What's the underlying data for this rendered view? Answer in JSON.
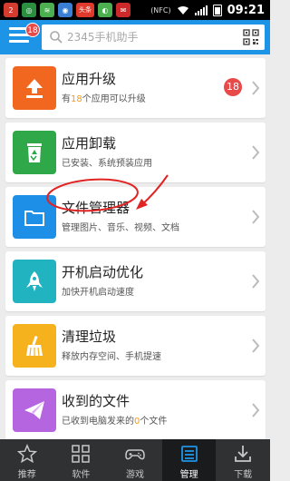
{
  "status_bar": {
    "time": "09:21",
    "nfc": "(NFC)",
    "left_icons": [
      {
        "name": "notification-app-icon",
        "color": "#d63b2f",
        "glyph": "2"
      },
      {
        "name": "sync-icon",
        "color": "#2a8f3e",
        "glyph": "◎"
      },
      {
        "name": "wifi-app-icon",
        "color": "#4caf50",
        "glyph": "≋"
      },
      {
        "name": "app-icon",
        "color": "#3a7fd5",
        "glyph": "◉"
      },
      {
        "name": "news-app-icon",
        "color": "#e03a2c",
        "glyph": "头条"
      },
      {
        "name": "app-icon-2",
        "color": "#4caf50",
        "glyph": "◐"
      },
      {
        "name": "app-icon-3",
        "color": "#cc2a2a",
        "glyph": "✉"
      }
    ]
  },
  "header": {
    "menu_badge": "18",
    "search_placeholder": "2345手机助手"
  },
  "items": [
    {
      "title": "应用升级",
      "sub_prefix": "有",
      "sub_highlight": "18",
      "sub_suffix": "个应用可以升级",
      "badge": "18",
      "color": "#f2671f"
    },
    {
      "title": "应用卸载",
      "sub_prefix": "已安装、系统预装应用",
      "sub_highlight": "",
      "sub_suffix": "",
      "badge": "",
      "color": "#2fa84a"
    },
    {
      "title": "文件管理器",
      "sub_prefix": "管理图片、音乐、视频、文档",
      "sub_highlight": "",
      "sub_suffix": "",
      "badge": "",
      "color": "#1e8fe6"
    },
    {
      "title": "开机启动优化",
      "sub_prefix": "加快开机启动速度",
      "sub_highlight": "",
      "sub_suffix": "",
      "badge": "",
      "color": "#21b3bf"
    },
    {
      "title": "清理垃圾",
      "sub_prefix": "释放内存空间、手机提速",
      "sub_highlight": "",
      "sub_suffix": "",
      "badge": "",
      "color": "#f6b21d"
    },
    {
      "title": "收到的文件",
      "sub_prefix": "已收到电脑发来的",
      "sub_highlight": "0",
      "sub_suffix": "个文件",
      "badge": "",
      "color": "#b565e0"
    }
  ],
  "annotation_color": "#e02424",
  "tabs": [
    {
      "label": "推荐",
      "icon": "star-icon"
    },
    {
      "label": "软件",
      "icon": "grid-icon"
    },
    {
      "label": "游戏",
      "icon": "gamepad-icon"
    },
    {
      "label": "管理",
      "icon": "manage-icon"
    },
    {
      "label": "下载",
      "icon": "download-icon"
    }
  ]
}
